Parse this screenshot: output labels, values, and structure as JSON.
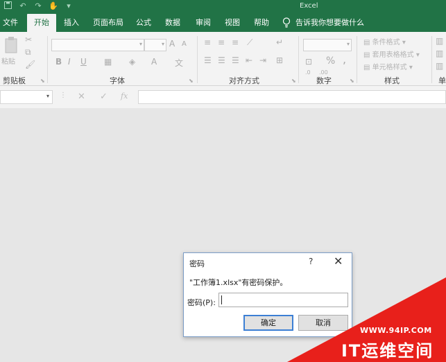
{
  "titlebar": {
    "title": "Excel",
    "qat_icons": [
      "save-icon",
      "undo-icon",
      "redo-icon",
      "touch-mode-icon",
      "customize-icon"
    ]
  },
  "tabs": [
    {
      "label": "文件"
    },
    {
      "label": "开始",
      "active": true
    },
    {
      "label": "插入"
    },
    {
      "label": "页面布局"
    },
    {
      "label": "公式"
    },
    {
      "label": "数据"
    },
    {
      "label": "审阅"
    },
    {
      "label": "视图"
    },
    {
      "label": "帮助"
    }
  ],
  "tellme": {
    "placeholder": "告诉我你想要做什么"
  },
  "ribbon": {
    "groups": {
      "clipboard": "剪贴板",
      "font": "字体",
      "alignment": "对齐方式",
      "number": "数字",
      "styles": "样式",
      "cells_partial": "单"
    },
    "clipboard": {
      "paste_label": "粘贴"
    },
    "styles": {
      "conditional": "条件格式",
      "table": "套用表格格式",
      "cell": "单元格样式"
    },
    "number": {
      "percent": "%",
      "comma": ","
    },
    "font": {
      "bold": "B",
      "italic": "I",
      "underline": "U",
      "grow": "A",
      "shrink": "A",
      "color": "A"
    }
  },
  "formulabar": {
    "name_value": "",
    "formula_value": "",
    "fx": "fx"
  },
  "dialog": {
    "title": "密码",
    "help": "?",
    "close": "✕",
    "message": "\"工作簿1.xlsx\"有密码保护。",
    "password_label": "密码(P):",
    "password_value": "",
    "ok_label": "确定",
    "cancel_label": "取消"
  },
  "watermark": {
    "url": "WWW.94IP.COM",
    "brand": "IT运维空间"
  },
  "colors": {
    "excel_green": "#217346",
    "ribbon_bg": "#f3f3f3",
    "workspace_bg": "#e6e6e6",
    "watermark_red": "#e8201b",
    "focus_blue": "#3c7fd4"
  }
}
